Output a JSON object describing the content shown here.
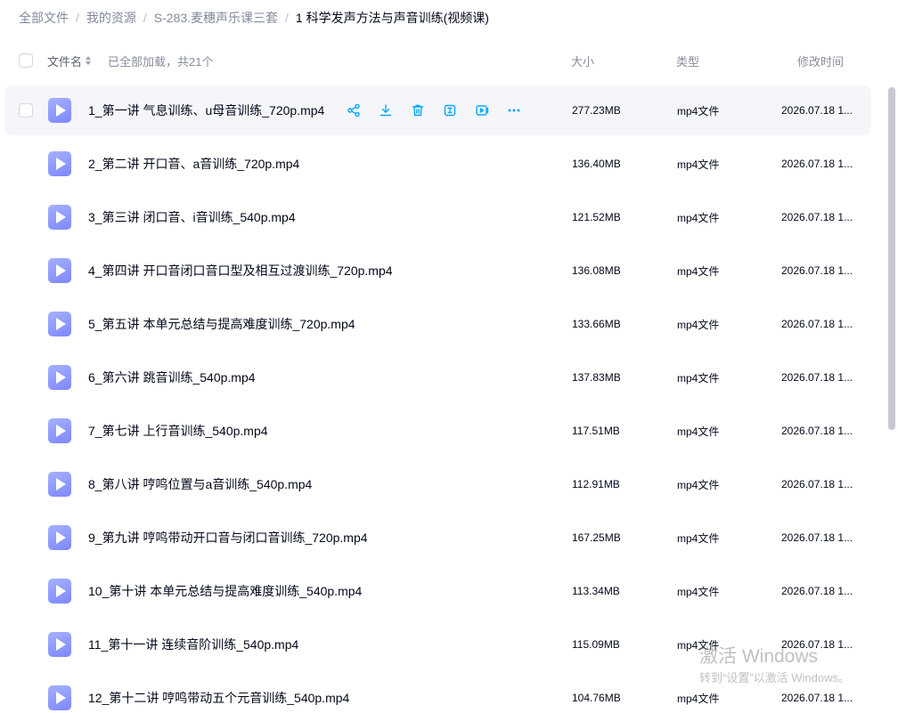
{
  "breadcrumb": [
    {
      "label": "全部文件"
    },
    {
      "label": "我的资源"
    },
    {
      "label": "S-283.麦穗声乐课三套"
    },
    {
      "label": "1 科学发声方法与声音训练(视频课)"
    }
  ],
  "header": {
    "name_label": "文件名",
    "loaded_label": "已全部加载，共21个",
    "size_label": "大小",
    "type_label": "类型",
    "time_label": "修改时间"
  },
  "colors": {
    "accent": "#06a7ff",
    "file_icon": "#8c96ff",
    "row_hover": "#f5f6fa"
  },
  "row_actions": [
    {
      "icon": "share-icon"
    },
    {
      "icon": "download-icon"
    },
    {
      "icon": "delete-icon"
    },
    {
      "icon": "rename-icon"
    },
    {
      "icon": "play-icon"
    },
    {
      "icon": "more-icon"
    }
  ],
  "files": [
    {
      "name": "1_第一讲 气息训练、u母音训练_720p.mp4",
      "size": "277.23MB",
      "type": "mp4文件",
      "modified": "2026.07.18 1..."
    },
    {
      "name": "2_第二讲 开口音、a音训练_720p.mp4",
      "size": "136.40MB",
      "type": "mp4文件",
      "modified": "2026.07.18 1..."
    },
    {
      "name": "3_第三讲 闭口音、i音训练_540p.mp4",
      "size": "121.52MB",
      "type": "mp4文件",
      "modified": "2026.07.18 1..."
    },
    {
      "name": "4_第四讲 开口音闭口音口型及相互过渡训练_720p.mp4",
      "size": "136.08MB",
      "type": "mp4文件",
      "modified": "2026.07.18 1..."
    },
    {
      "name": "5_第五讲 本单元总结与提高难度训练_720p.mp4",
      "size": "133.66MB",
      "type": "mp4文件",
      "modified": "2026.07.18 1..."
    },
    {
      "name": "6_第六讲 跳音训练_540p.mp4",
      "size": "137.83MB",
      "type": "mp4文件",
      "modified": "2026.07.18 1..."
    },
    {
      "name": "7_第七讲 上行音训练_540p.mp4",
      "size": "117.51MB",
      "type": "mp4文件",
      "modified": "2026.07.18 1..."
    },
    {
      "name": "8_第八讲 哼鸣位置与a音训练_540p.mp4",
      "size": "112.91MB",
      "type": "mp4文件",
      "modified": "2026.07.18 1..."
    },
    {
      "name": "9_第九讲 哼鸣带动开口音与闭口音训练_720p.mp4",
      "size": "167.25MB",
      "type": "mp4文件",
      "modified": "2026.07.18 1..."
    },
    {
      "name": "10_第十讲 本单元总结与提高难度训练_540p.mp4",
      "size": "113.34MB",
      "type": "mp4文件",
      "modified": "2026.07.18 1..."
    },
    {
      "name": "11_第十一讲 连续音阶训练_540p.mp4",
      "size": "115.09MB",
      "type": "mp4文件",
      "modified": "2026.07.18 1..."
    },
    {
      "name": "12_第十二讲 哼鸣带动五个元音训练_540p.mp4",
      "size": "104.76MB",
      "type": "mp4文件",
      "modified": "2026.07.18 1..."
    }
  ],
  "watermark": {
    "line1": "激活 Windows",
    "line2": "转到“设置”以激活 Windows。"
  }
}
